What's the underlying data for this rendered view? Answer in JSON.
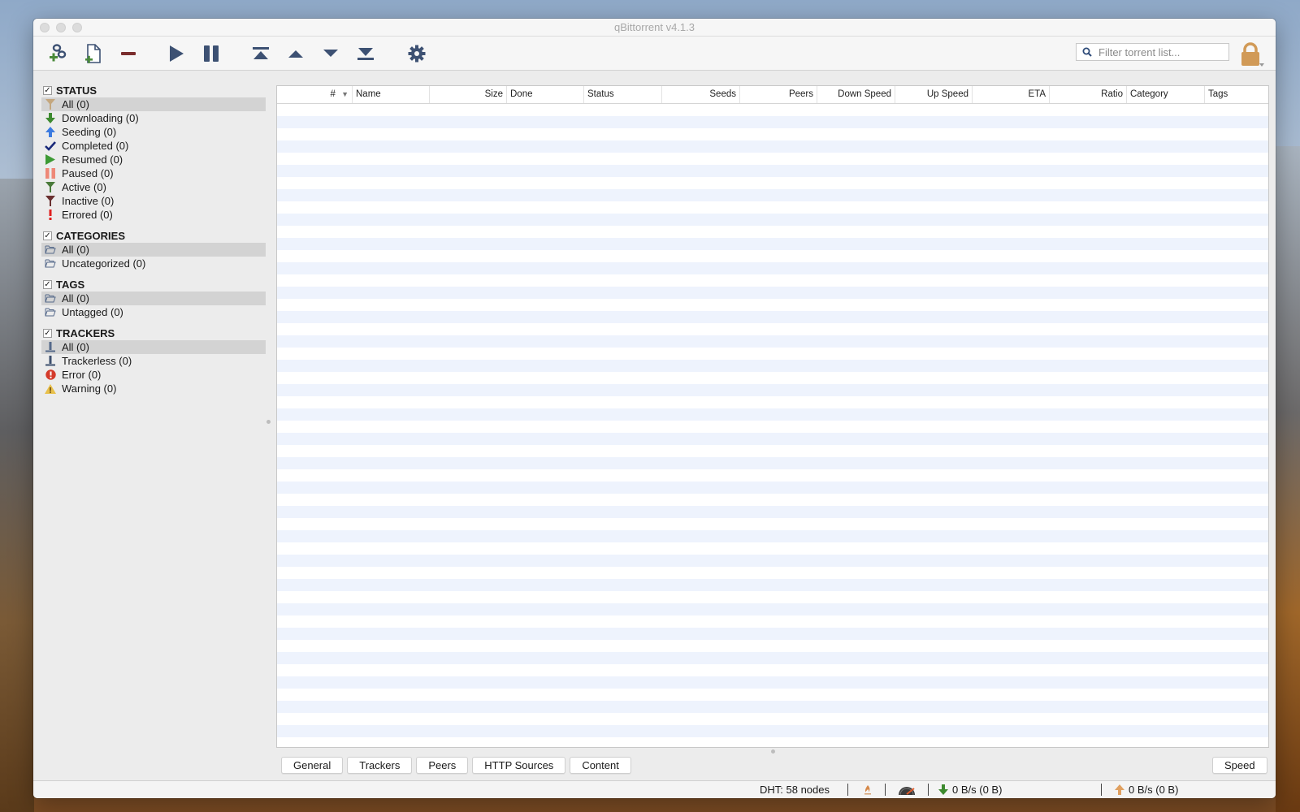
{
  "window": {
    "title": "qBittorrent v4.1.3"
  },
  "toolbar": {
    "buttons": [
      {
        "name": "add-torrent-link",
        "icon": "link-plus-icon"
      },
      {
        "name": "add-torrent-file",
        "icon": "file-plus-icon"
      },
      {
        "name": "delete",
        "icon": "minus-icon"
      },
      {
        "name": "resume",
        "icon": "play-icon"
      },
      {
        "name": "pause",
        "icon": "pause-icon"
      },
      {
        "name": "move-top",
        "icon": "move-top-icon"
      },
      {
        "name": "move-up",
        "icon": "move-up-icon"
      },
      {
        "name": "move-down",
        "icon": "move-down-icon"
      },
      {
        "name": "move-bottom",
        "icon": "move-bottom-icon"
      },
      {
        "name": "options",
        "icon": "gear-icon"
      }
    ],
    "search_placeholder": "Filter torrent list...",
    "search_value": "",
    "lock_icon": "lock-icon"
  },
  "sidebar": {
    "status": {
      "title": "STATUS",
      "checked": true,
      "items": [
        {
          "label": "All (0)",
          "icon": "filter-icon",
          "selected": true
        },
        {
          "label": "Downloading (0)",
          "icon": "arrow-down-icon"
        },
        {
          "label": "Seeding (0)",
          "icon": "arrow-up-icon"
        },
        {
          "label": "Completed (0)",
          "icon": "checkmark-icon"
        },
        {
          "label": "Resumed (0)",
          "icon": "play-icon"
        },
        {
          "label": "Paused (0)",
          "icon": "pause-icon"
        },
        {
          "label": "Active (0)",
          "icon": "filter-active-icon"
        },
        {
          "label": "Inactive (0)",
          "icon": "filter-inactive-icon"
        },
        {
          "label": "Errored (0)",
          "icon": "exclamation-icon"
        }
      ]
    },
    "categories": {
      "title": "CATEGORIES",
      "checked": true,
      "items": [
        {
          "label": "All (0)",
          "icon": "folder-icon",
          "selected": true
        },
        {
          "label": "Uncategorized (0)",
          "icon": "folder-icon"
        }
      ]
    },
    "tags": {
      "title": "TAGS",
      "checked": true,
      "items": [
        {
          "label": "All (0)",
          "icon": "folder-icon",
          "selected": true
        },
        {
          "label": "Untagged (0)",
          "icon": "folder-icon"
        }
      ]
    },
    "trackers": {
      "title": "TRACKERS",
      "checked": true,
      "items": [
        {
          "label": "All (0)",
          "icon": "tracker-icon",
          "selected": true
        },
        {
          "label": "Trackerless (0)",
          "icon": "tracker-icon"
        },
        {
          "label": "Error (0)",
          "icon": "error-icon"
        },
        {
          "label": "Warning (0)",
          "icon": "warning-icon"
        }
      ]
    }
  },
  "table": {
    "columns": [
      "#",
      "Name",
      "Size",
      "Done",
      "Status",
      "Seeds",
      "Peers",
      "Down Speed",
      "Up Speed",
      "ETA",
      "Ratio",
      "Category",
      "Tags"
    ],
    "sort_column": "#",
    "sort_direction": "descending",
    "rows": []
  },
  "bottom_tabs": [
    "General",
    "Trackers",
    "Peers",
    "HTTP Sources",
    "Content"
  ],
  "speed_button": "Speed",
  "statusbar": {
    "dht": "DHT: 58 nodes",
    "download": "0 B/s (0 B)",
    "upload": "0 B/s (0 B)",
    "connection_icon": "firewall-icon",
    "speed_limit_icon": "speedometer-icon"
  },
  "colors": {
    "toolbar_icon": "#3d5173",
    "row_alt": "#eef3fd",
    "selected_item": "#d3d3d3",
    "lock": "#d19a57"
  }
}
